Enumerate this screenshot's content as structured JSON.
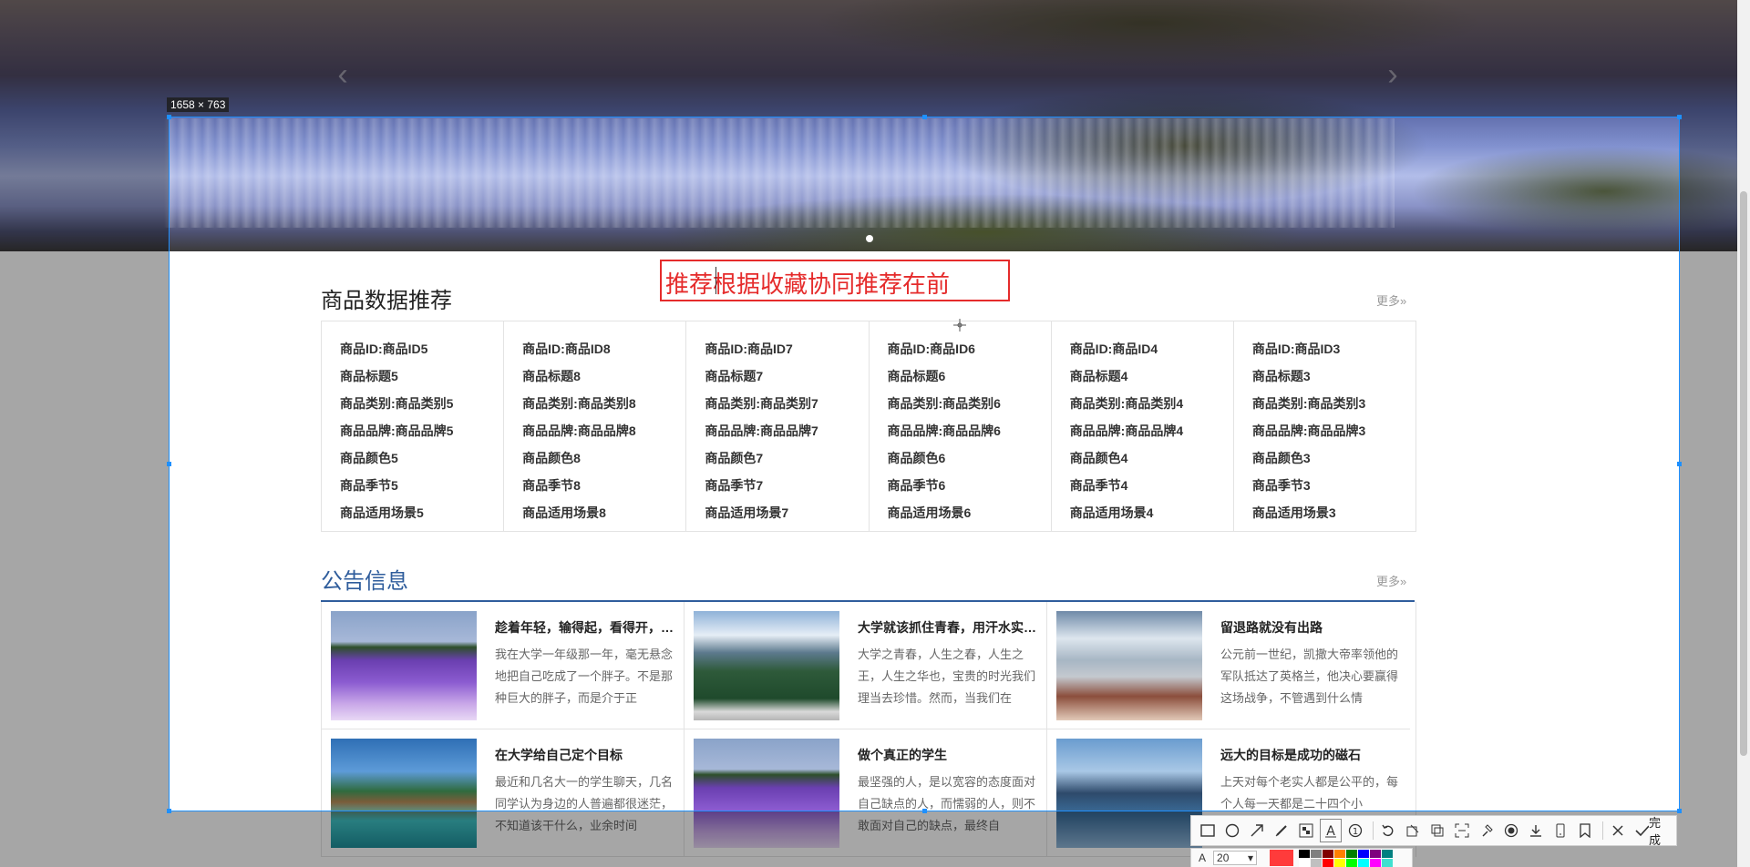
{
  "selection": {
    "size_label": "1658 × 763"
  },
  "annotation": {
    "text": "推荐根据收藏协同推荐在前"
  },
  "recommend": {
    "title": "商品数据推荐",
    "more": "更多»",
    "items": [
      {
        "id": "商品ID:商品ID5",
        "title": "商品标题5",
        "category": "商品类别:商品类别5",
        "brand": "商品品牌:商品品牌5",
        "color": "商品颜色5",
        "season": "商品季节5",
        "scene": "商品适用场景5"
      },
      {
        "id": "商品ID:商品ID8",
        "title": "商品标题8",
        "category": "商品类别:商品类别8",
        "brand": "商品品牌:商品品牌8",
        "color": "商品颜色8",
        "season": "商品季节8",
        "scene": "商品适用场景8"
      },
      {
        "id": "商品ID:商品ID7",
        "title": "商品标题7",
        "category": "商品类别:商品类别7",
        "brand": "商品品牌:商品品牌7",
        "color": "商品颜色7",
        "season": "商品季节7",
        "scene": "商品适用场景7"
      },
      {
        "id": "商品ID:商品ID6",
        "title": "商品标题6",
        "category": "商品类别:商品类别6",
        "brand": "商品品牌:商品品牌6",
        "color": "商品颜色6",
        "season": "商品季节6",
        "scene": "商品适用场景6"
      },
      {
        "id": "商品ID:商品ID4",
        "title": "商品标题4",
        "category": "商品类别:商品类别4",
        "brand": "商品品牌:商品品牌4",
        "color": "商品颜色4",
        "season": "商品季节4",
        "scene": "商品适用场景4"
      },
      {
        "id": "商品ID:商品ID3",
        "title": "商品标题3",
        "category": "商品类别:商品类别3",
        "brand": "商品品牌:商品品牌3",
        "color": "商品颜色3",
        "season": "商品季节3",
        "scene": "商品适用场景3"
      }
    ]
  },
  "notices": {
    "title": "公告信息",
    "more": "更多»",
    "items": [
      {
        "title": "趁着年轻，输得起，看得开，…",
        "summary": "我在大学一年级那一年，毫无悬念地把自己吃成了一个胖子。不是那种巨大的胖子，而是介于正"
      },
      {
        "title": "大学就该抓住青春，用汗水实…",
        "summary": "大学之青春，人生之春，人生之王，人生之华也，宝贵的时光我们理当去珍惜。然而，当我们在"
      },
      {
        "title": "留退路就没有出路",
        "summary": "公元前一世纪，凯撒大帝率领他的军队抵达了英格兰，他决心要赢得这场战争，不管遇到什么情"
      },
      {
        "title": "在大学给自己定个目标",
        "summary": "最近和几名大一的学生聊天，几名同学认为身边的人普遍都很迷茫，不知道该干什么，业余时间"
      },
      {
        "title": "做个真正的学生",
        "summary": "最坚强的人，是以宽容的态度面对自己缺点的人，而懦弱的人，则不敢面对自己的缺点，最终自"
      },
      {
        "title": "远大的目标是成功的磁石",
        "summary": "上天对每个老实人都是公平的，每个人每一天都是二十四个小"
      }
    ]
  },
  "toolbar": {
    "tools": [
      "rectangle-icon",
      "ellipse-icon",
      "arrow-icon",
      "pen-icon",
      "mosaic-icon",
      "text-icon",
      "number-icon",
      "undo-icon",
      "pin-icon",
      "copy-icon",
      "ocr-icon",
      "topmost-icon",
      "record-icon",
      "save-icon",
      "phone-icon",
      "bookmark-icon",
      "close-icon"
    ],
    "done_label": "完成",
    "font_size": "20",
    "current_color": "#ff3b3b",
    "palette": [
      "#000000",
      "#808080",
      "#800000",
      "#ff8000",
      "#008000",
      "#0000ff",
      "#800080",
      "#008080",
      "#ffffff",
      "#c0c0c0",
      "#ff0000",
      "#ffff00",
      "#00ff00",
      "#00ffff",
      "#ff00ff",
      "#40e0d0"
    ]
  }
}
